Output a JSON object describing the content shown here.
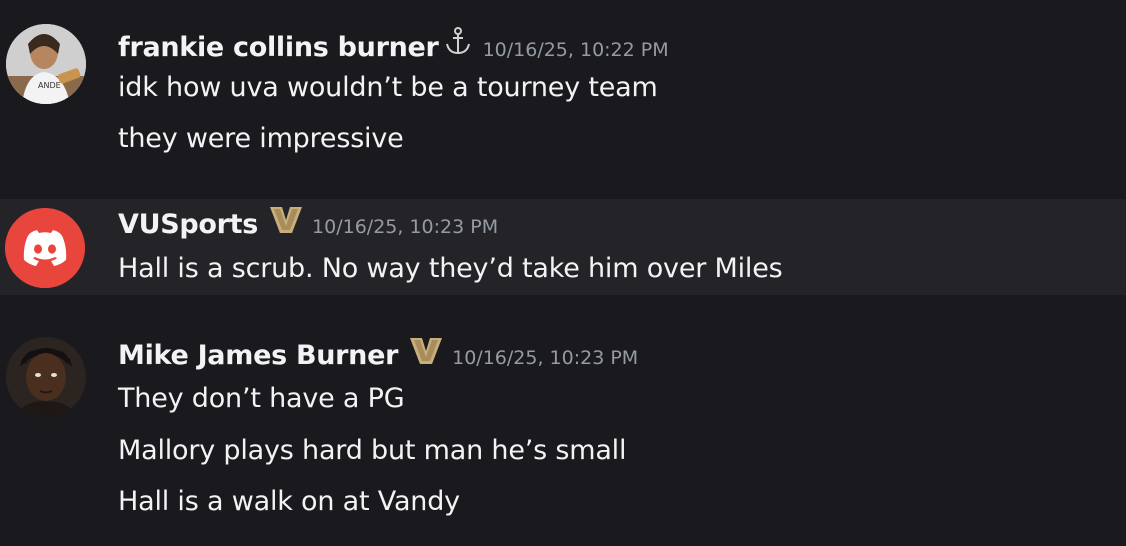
{
  "messages": [
    {
      "author": "frankie collins burner",
      "badge_icon": "anchor-icon",
      "timestamp": "10/16/25, 10:22 PM",
      "lines": [
        "idk how uva wouldn’t be a tourney team",
        "they were impressive"
      ]
    },
    {
      "author": "VUSports",
      "badge_icon": "vanderbilt-v-icon",
      "timestamp": "10/16/25, 10:23 PM",
      "lines": [
        "Hall is a scrub. No way they’d take him over Miles"
      ]
    },
    {
      "author": "Mike James Burner",
      "badge_icon": "vanderbilt-v-icon",
      "timestamp": "10/16/25, 10:23 PM",
      "lines": [
        "They don’t have a PG",
        "Mallory plays hard but man he’s small",
        "Hall is a walk on at Vandy"
      ]
    }
  ],
  "colors": {
    "background": "#1a1a1e",
    "highlight_row": "#242428",
    "discord_red": "#e8453c",
    "vandy_gold": "#c9ae7c",
    "timestamp": "#949ba4"
  }
}
